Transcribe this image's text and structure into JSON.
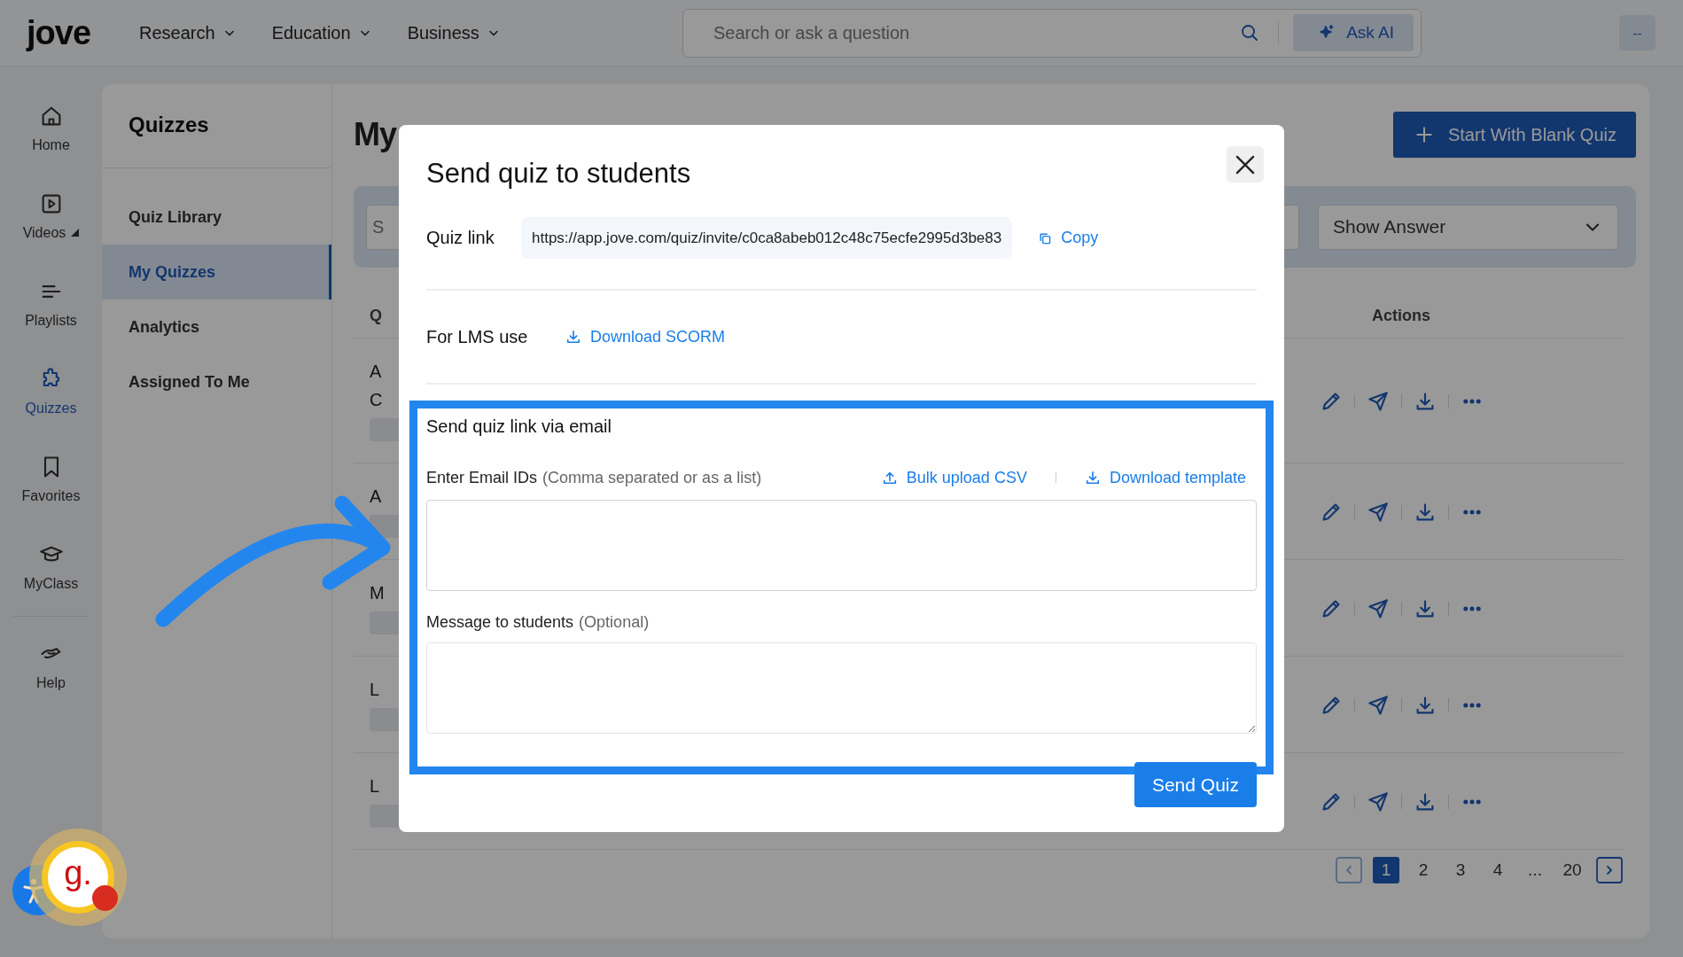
{
  "top_nav": {
    "logo": "jove",
    "menus": [
      {
        "label": "Research"
      },
      {
        "label": "Education"
      },
      {
        "label": "Business"
      }
    ],
    "search": {
      "placeholder": "Search or ask a question"
    },
    "ask_ai": "Ask AI",
    "account": "--"
  },
  "rail": [
    {
      "label": "Home",
      "selected": false,
      "expandable": false
    },
    {
      "label": "Videos",
      "selected": false,
      "expandable": true
    },
    {
      "label": "Playlists",
      "selected": false,
      "expandable": false
    },
    {
      "label": "Quizzes",
      "selected": true,
      "expandable": false
    },
    {
      "label": "Favorites",
      "selected": false,
      "expandable": false
    },
    {
      "label": "MyClass",
      "selected": false,
      "expandable": false
    },
    {
      "label": "Help",
      "selected": false,
      "expandable": false
    }
  ],
  "panel": {
    "title": "Quizzes",
    "items": [
      {
        "label": "Quiz Library",
        "selected": false
      },
      {
        "label": "My Quizzes",
        "selected": true
      },
      {
        "label": "Analytics",
        "selected": false
      },
      {
        "label": "Assigned To Me",
        "selected": false
      }
    ]
  },
  "main": {
    "title": "My",
    "start_button": "Start With Blank Quiz",
    "filter": {
      "search_placeholder": "S",
      "show_answer": "Show Answer"
    },
    "table": {
      "columns": [
        "Q",
        "Actions"
      ],
      "rows": [
        {
          "lines": [
            "A",
            "C"
          ]
        },
        {
          "lines": [
            "A"
          ]
        },
        {
          "lines": [
            "M"
          ]
        },
        {
          "lines": [
            "L"
          ]
        },
        {
          "lines": [
            "L"
          ]
        }
      ]
    },
    "pagination": [
      {
        "label": "1",
        "selected": true
      },
      {
        "label": "2",
        "selected": false
      },
      {
        "label": "3",
        "selected": false
      },
      {
        "label": "4",
        "selected": false
      },
      {
        "label": "...",
        "selected": false
      },
      {
        "label": "20",
        "selected": false
      }
    ]
  },
  "modal": {
    "title": "Send quiz to students",
    "quiz_link": {
      "label": "Quiz link",
      "value": "https://app.jove.com/quiz/invite/c0ca8abeb012c48c75ecfe2995d3be83",
      "copy": "Copy"
    },
    "lms": {
      "label": "For LMS use",
      "download": "Download SCORM"
    },
    "email": {
      "title": "Send quiz link via email",
      "label": "Enter Email IDs",
      "hint": "(Comma separated or as a list)",
      "bulk_upload": "Bulk upload CSV",
      "template": "Download template",
      "message_label": "Message to students",
      "message_hint": "(Optional)"
    },
    "send": "Send Quiz"
  },
  "widgets": {
    "assistant_badge": "g."
  }
}
